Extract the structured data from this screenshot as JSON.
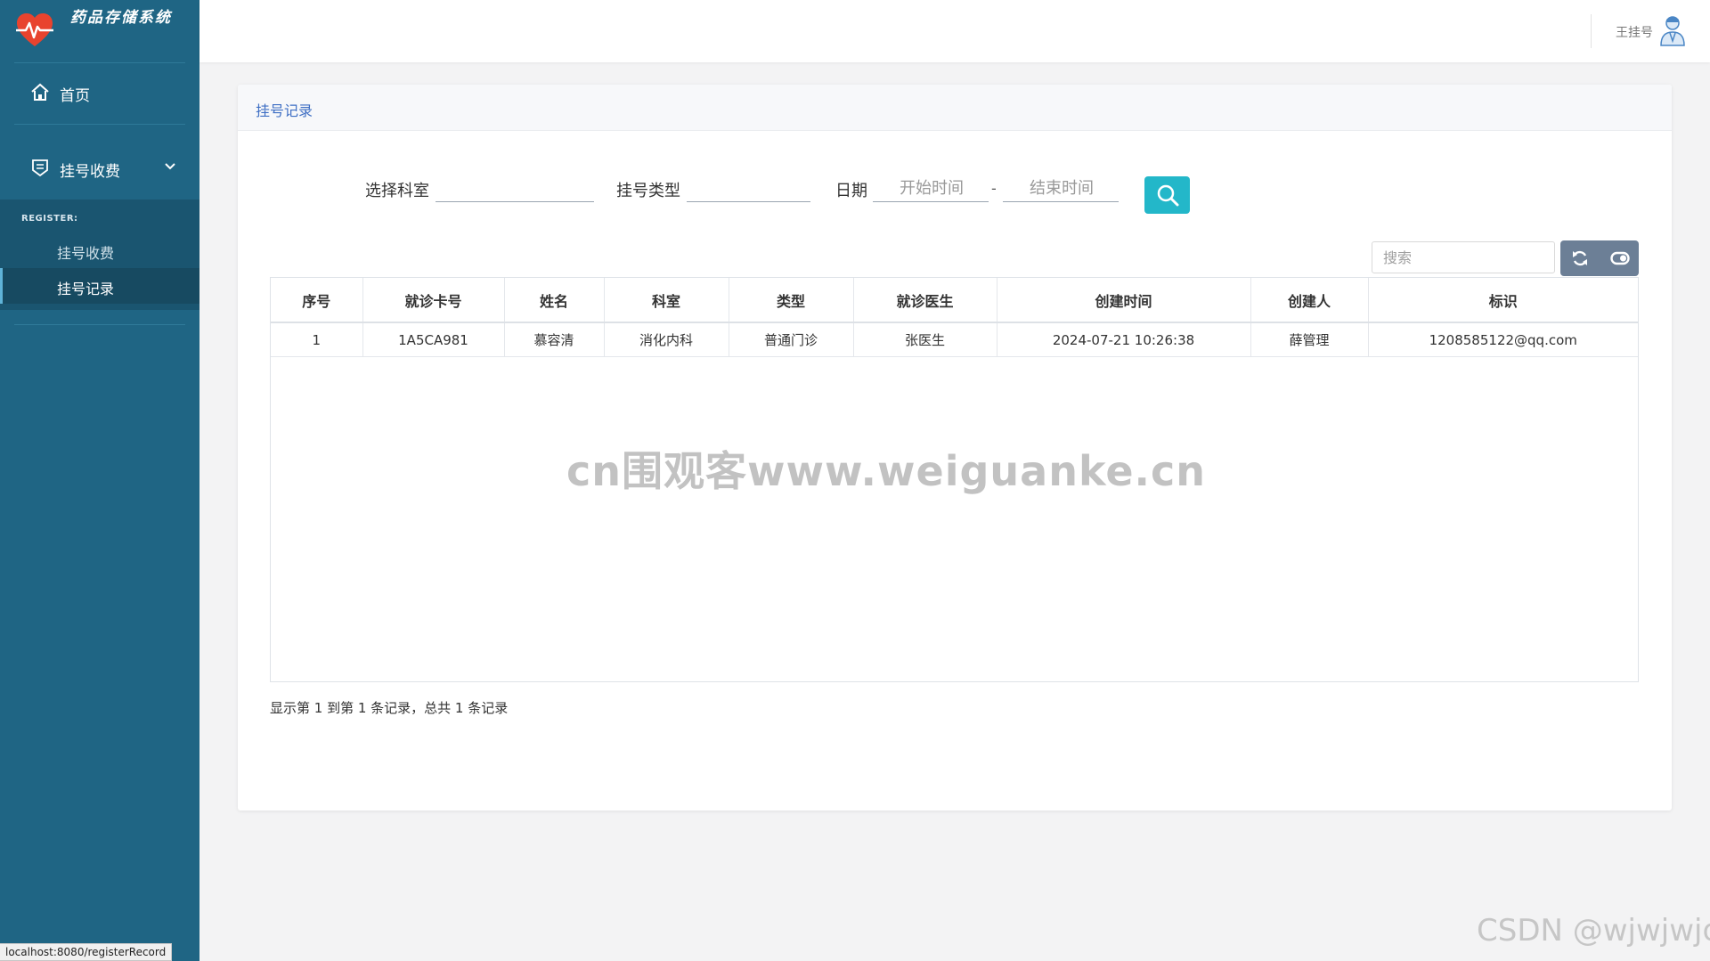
{
  "app": {
    "title": "药品存储系统"
  },
  "sidebar": {
    "home_label": "首页",
    "menu_label": "挂号收费",
    "section_label": "REGISTER:",
    "sub_items": [
      {
        "label": "挂号收费"
      },
      {
        "label": "挂号记录"
      }
    ]
  },
  "header": {
    "user_name": "王挂号"
  },
  "panel": {
    "title": "挂号记录"
  },
  "filters": {
    "department_label": "选择科室",
    "department_value": "",
    "type_label": "挂号类型",
    "type_value": "",
    "date_label": "日期",
    "start_placeholder": "开始时间",
    "separator": "-",
    "end_placeholder": "结束时间"
  },
  "toolbar": {
    "search_placeholder": "搜索"
  },
  "table": {
    "columns": [
      "序号",
      "就诊卡号",
      "姓名",
      "科室",
      "类型",
      "就诊医生",
      "创建时间",
      "创建人",
      "标识"
    ],
    "rows": [
      [
        "1",
        "1A5CA981",
        "慕容清",
        "消化内科",
        "普通门诊",
        "张医生",
        "2024-07-21 10:26:38",
        "薛管理",
        "1208585122@qq.com"
      ]
    ]
  },
  "pagination": {
    "info": "显示第 1 到第 1 条记录，总共 1 条记录"
  },
  "watermark": "cn围观客www.weiguanke.cn",
  "csdn_watermark": "CSDN @wjwjwjd",
  "status_url": "localhost:8080/registerRecord",
  "colors": {
    "sidebar": "#1f6584",
    "accent": "#23b7c9",
    "link": "#3f6fc4"
  },
  "icons": [
    "heart-pulse-icon",
    "home-icon",
    "register-icon",
    "chevron-down-icon",
    "search-icon",
    "refresh-icon",
    "toggle-icon",
    "user-avatar-icon"
  ]
}
